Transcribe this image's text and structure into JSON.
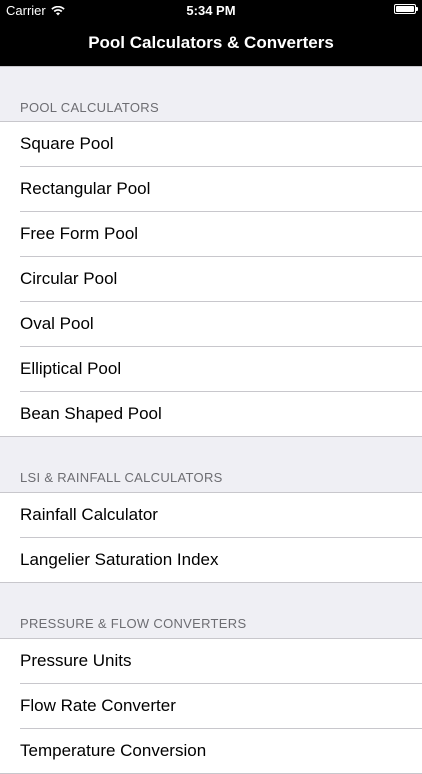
{
  "status_bar": {
    "carrier": "Carrier",
    "time": "5:34 PM",
    "battery_level": 1.0
  },
  "nav": {
    "title": "Pool Calculators & Converters"
  },
  "sections": [
    {
      "header": "POOL CALCULATORS",
      "items": [
        "Square Pool",
        "Rectangular Pool",
        "Free Form Pool",
        "Circular Pool",
        "Oval Pool",
        "Elliptical Pool",
        "Bean Shaped Pool"
      ]
    },
    {
      "header": "LSI & RAINFALL CALCULATORS",
      "items": [
        "Rainfall Calculator",
        "Langelier Saturation Index"
      ]
    },
    {
      "header": "PRESSURE & FLOW CONVERTERS",
      "items": [
        "Pressure Units",
        "Flow Rate Converter",
        "Temperature Conversion"
      ]
    }
  ]
}
